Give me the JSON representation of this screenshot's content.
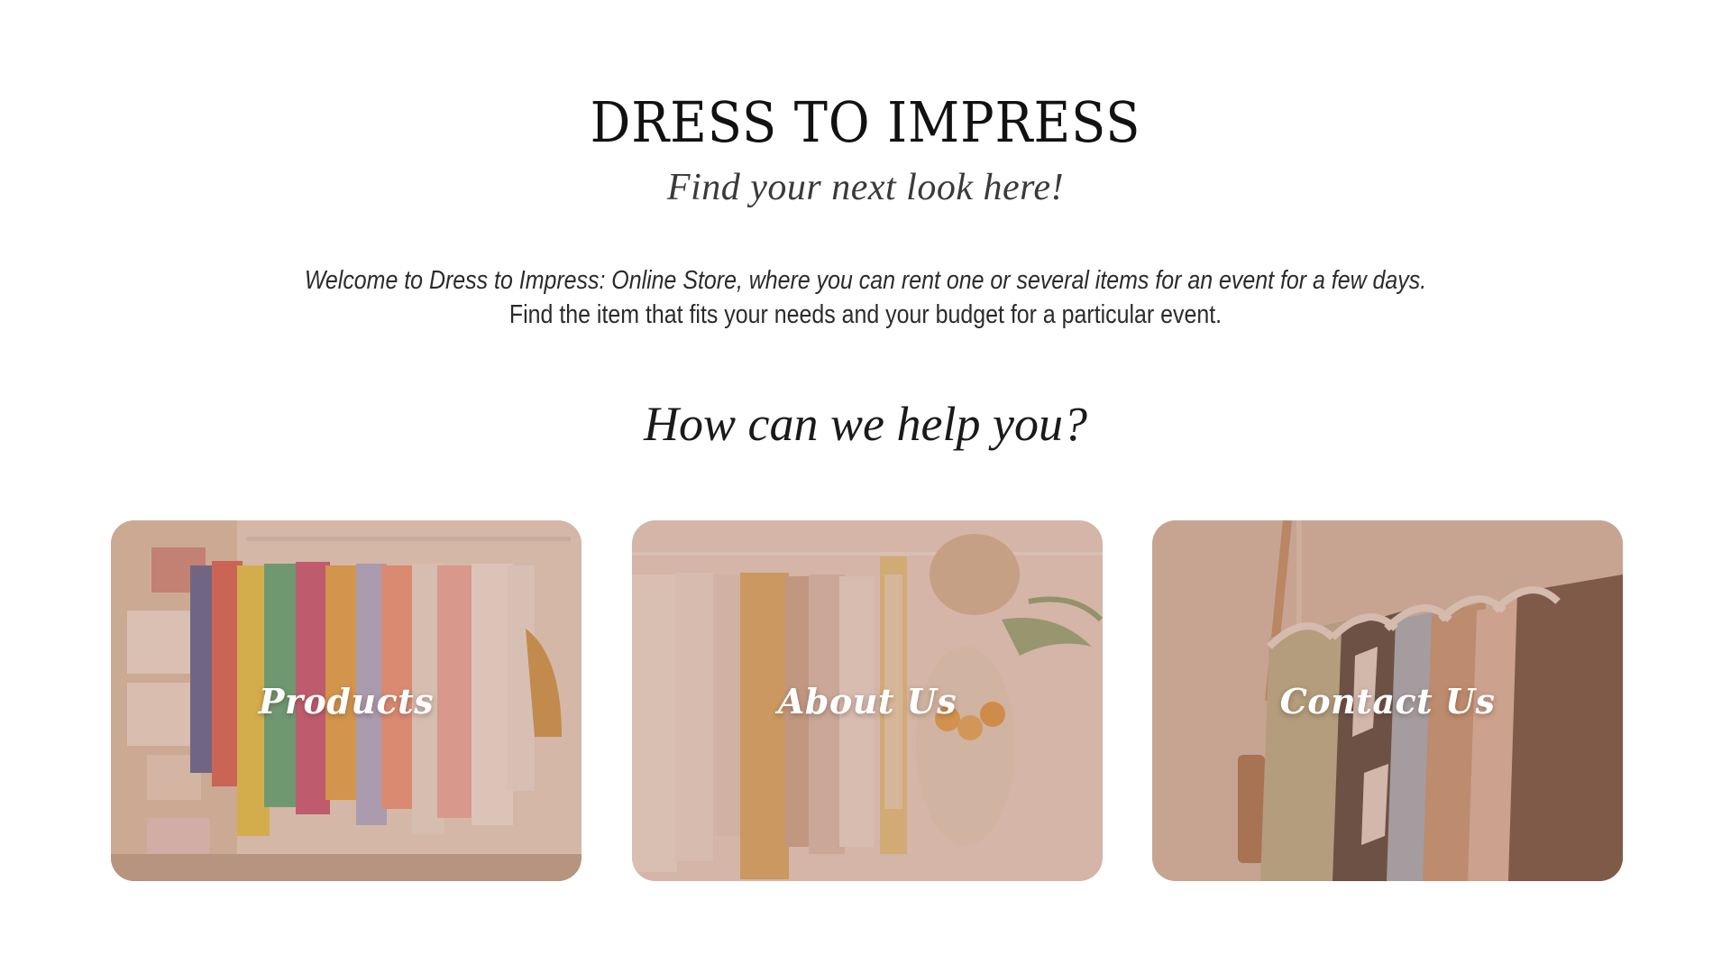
{
  "header": {
    "title": "DRESS TO IMPRESS",
    "tagline": "Find your next look here!"
  },
  "intro": {
    "line1": "Welcome to Dress to Impress: Online Store, where you can rent one or several items for an event for a few days.",
    "line2": "Find the item that fits your needs and your budget for a particular event."
  },
  "help": {
    "heading": "How can we help you?"
  },
  "cards": [
    {
      "label": "Products",
      "icon": "clothes-rack-colorful-photo"
    },
    {
      "label": "About Us",
      "icon": "clothes-rack-neutral-photo"
    },
    {
      "label": "Contact Us",
      "icon": "hangers-closeup-photo"
    }
  ],
  "colors": {
    "card_overlay": "#b98a7a",
    "text_dark": "#1a1a1a",
    "card_label": "#ffffff"
  }
}
